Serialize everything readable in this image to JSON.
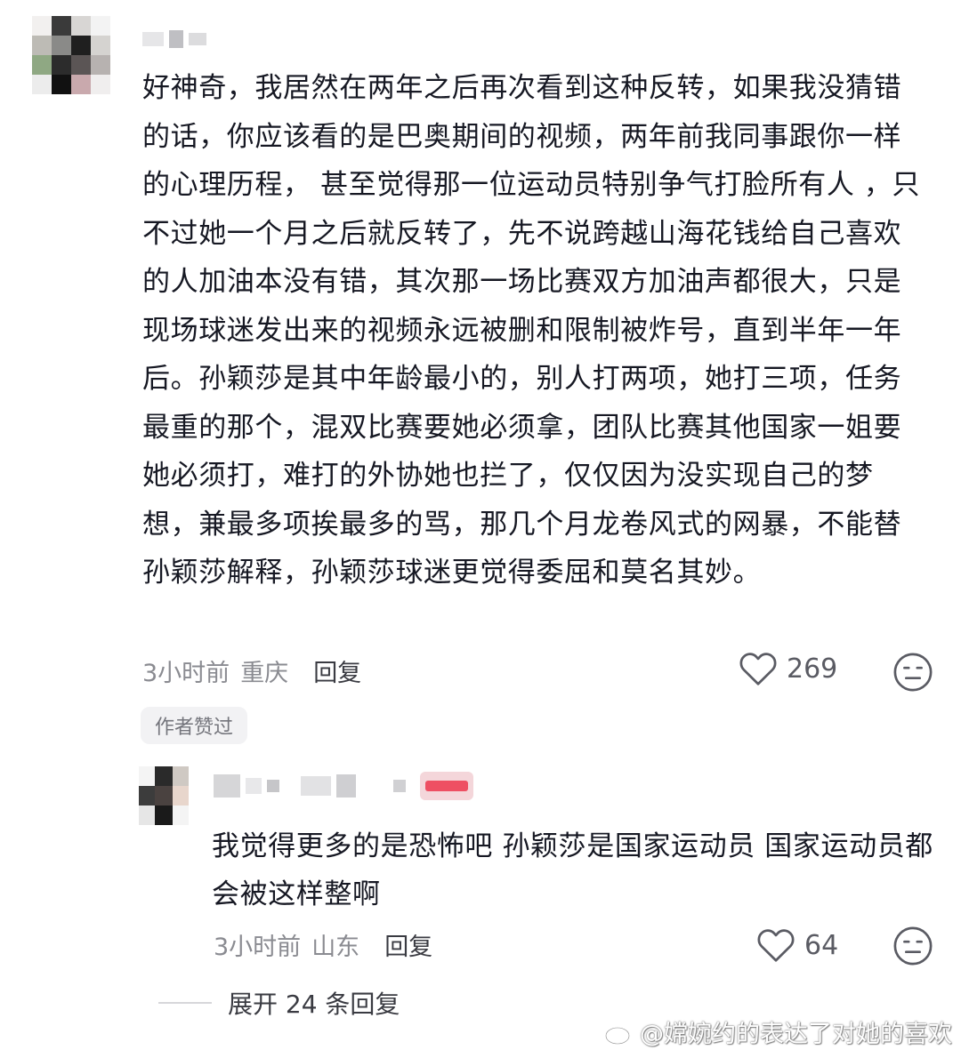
{
  "comment": {
    "text": "好神奇，我居然在两年之后再次看到这种反转，如果我没猜错的话，你应该看的是巴奥期间的视频，两年前我同事跟你一样的心理历程， 甚至觉得那一位运动员特别争气打脸所有人 ，只不过她一个月之后就反转了，先不说跨越山海花钱给自己喜欢的人加油本没有错，其次那一场比赛双方加油声都很大，只是现场球迷发出来的视频永远被删和限制被炸号，直到半年一年后。孙颖莎是其中年龄最小的，别人打两项，她打三项，任务最重的那个，混双比赛要她必须拿，团队比赛其他国家一姐要她必须打，难打的外协她也拦了，仅仅因为没实现自己的梦想，兼最多项挨最多的骂，那几个月龙卷风式的网暴，不能替孙颖莎解释，孙颖莎球迷更觉得委屈和莫名其妙。",
    "time": "3小时前",
    "location": "重庆",
    "reply_label": "回复",
    "likes": "269",
    "badge": "作者赞过"
  },
  "reply": {
    "text": "我觉得更多的是恐怖吧 孙颖莎是国家运动员 国家运动员都会被这样整啊",
    "time": "3小时前",
    "location": "山东",
    "reply_label": "回复",
    "likes": "64"
  },
  "expand_label": "展开 24 条回复",
  "watermark": "@嫦婉约的表达了对她的喜欢",
  "icons": {
    "like": "heart-outline-icon",
    "dislike": "meh-face-icon",
    "watermark": "weibo-icon"
  }
}
